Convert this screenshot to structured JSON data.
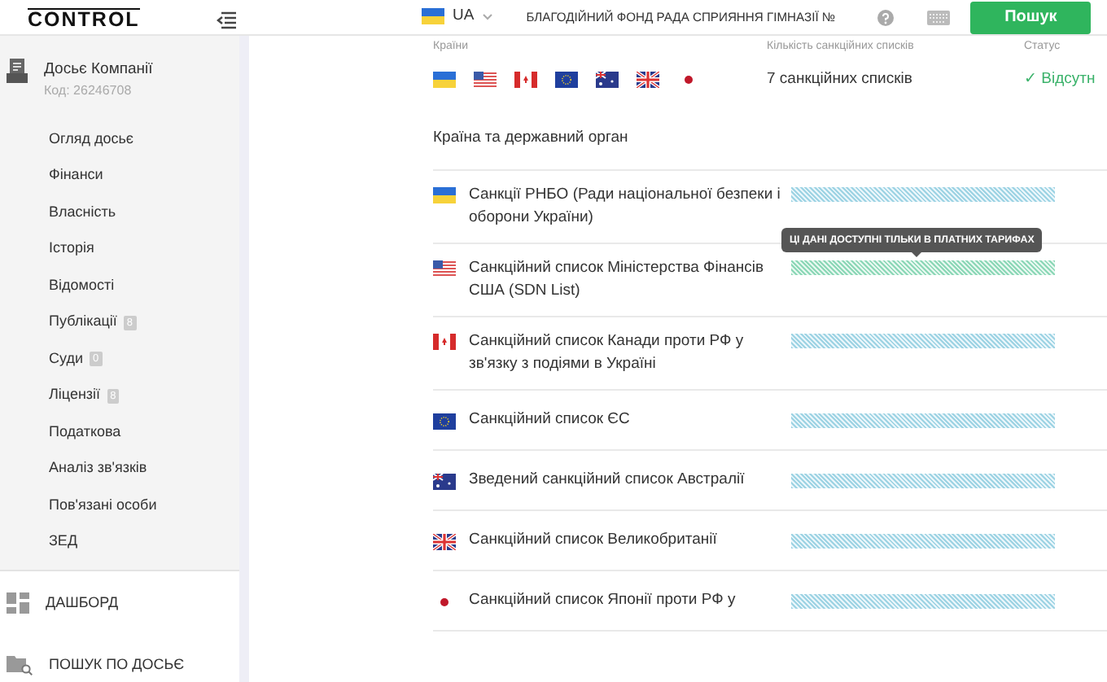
{
  "logo": {
    "text": "CONTROL"
  },
  "search": {
    "country": "UA",
    "flag": {
      "kind": "ua"
    },
    "value": "БЛАГОДІЙНИЙ ФОНД РАДА СПРИЯННЯ ГІМНАЗІЇ №",
    "button": "Пошук"
  },
  "sidebar": {
    "dossier": {
      "title": "Досьє Компанії",
      "code": "Код: 26246708"
    },
    "items": [
      {
        "label": "Огляд досьє"
      },
      {
        "label": "Фінанси"
      },
      {
        "label": "Власність"
      },
      {
        "label": "Історія"
      },
      {
        "label": "Відомості"
      },
      {
        "label": "Публікації",
        "badge": "8"
      },
      {
        "label": "Суди",
        "badge": "0"
      },
      {
        "label": "Ліцензії",
        "badge": "8"
      },
      {
        "label": "Податкова"
      },
      {
        "label": "Аналіз зв'язків"
      },
      {
        "label": "Пов'язані особи"
      },
      {
        "label": "ЗЕД"
      }
    ],
    "bottom": [
      {
        "label": "ДАШБОРД",
        "kind": "dashboard"
      },
      {
        "label": "ПОШУК ПО ДОСЬЄ",
        "kind": "search"
      }
    ]
  },
  "summary": {
    "columns": [
      "Країни",
      "Кількість санкційних списків",
      "Статус"
    ],
    "flags": [
      {
        "kind": "ua"
      },
      {
        "kind": "us"
      },
      {
        "kind": "ca"
      },
      {
        "kind": "eu"
      },
      {
        "kind": "au"
      },
      {
        "kind": "gb"
      },
      {
        "kind": "jp"
      }
    ],
    "count": "7 санкційних списків",
    "status": "✓ Відсутн"
  },
  "table": {
    "heading": "Країна та державний орган",
    "rows": [
      {
        "kind": "ua",
        "name": "Санкції РНБО (Ради національної безпеки і оборони України)",
        "hovered": false
      },
      {
        "kind": "us",
        "name": "Санкційний список Міністерства Фінансів США (SDN List)",
        "hovered": true
      },
      {
        "kind": "ca",
        "name": "Санкційний список Канади проти РФ у зв'язку з подіями в Україні",
        "hovered": false
      },
      {
        "kind": "eu",
        "name": "Санкційний список ЄС",
        "hovered": false
      },
      {
        "kind": "au",
        "name": "Зведений санкційний список Австралії",
        "hovered": false
      },
      {
        "kind": "gb",
        "name": "Санкційний список Великобританії",
        "hovered": false
      },
      {
        "kind": "jp",
        "name": "Санкційний список Японії проти РФ у",
        "hovered": false
      }
    ],
    "tooltip": "ЦІ ДАНІ ДОСТУПНІ ТІЛЬКИ В ПЛАТНИХ ТАРИФАХ"
  }
}
